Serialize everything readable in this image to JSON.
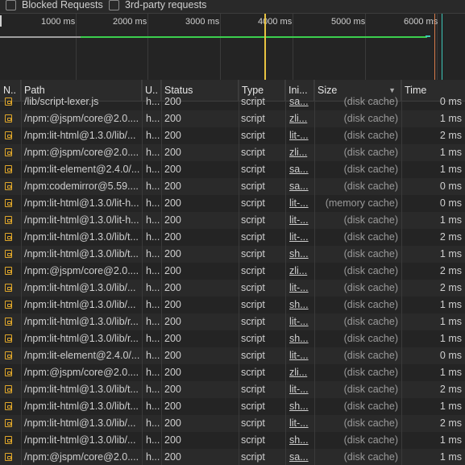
{
  "filter_bar": {
    "blocked_requests_label": "Blocked Requests",
    "third_party_label": "3rd-party requests"
  },
  "overview": {
    "tick_labels": [
      "1000 ms",
      "2000 ms",
      "3000 ms",
      "4000 ms",
      "5000 ms",
      "6000 ms"
    ],
    "colors": {
      "green": "#3ccf4e",
      "gray": "#9e9e9e",
      "dcl_line": "#e8c341",
      "load_line": "#d87c4b",
      "teal": "#3cc6b8"
    }
  },
  "table": {
    "columns": {
      "name": "N..",
      "path": "Path",
      "url": "U..",
      "status": "Status",
      "type": "Type",
      "initiator": "Ini...",
      "size": "Size",
      "time": "Time"
    },
    "sort_indicator": "▼",
    "rows": [
      {
        "path": "/lib/script-lexer.js",
        "url": "h...",
        "status": "200",
        "type": "script",
        "initiator": "sa...",
        "size": "(disk cache)",
        "time": "0 ms"
      },
      {
        "path": "/npm:@jspm/core@2.0....",
        "url": "h...",
        "status": "200",
        "type": "script",
        "initiator": "zli...",
        "size": "(disk cache)",
        "time": "1 ms"
      },
      {
        "path": "/npm:lit-html@1.3.0/lib/...",
        "url": "h...",
        "status": "200",
        "type": "script",
        "initiator": "lit-...",
        "size": "(disk cache)",
        "time": "2 ms"
      },
      {
        "path": "/npm:@jspm/core@2.0....",
        "url": "h...",
        "status": "200",
        "type": "script",
        "initiator": "zli...",
        "size": "(disk cache)",
        "time": "1 ms"
      },
      {
        "path": "/npm:lit-element@2.4.0/...",
        "url": "h...",
        "status": "200",
        "type": "script",
        "initiator": "sa...",
        "size": "(disk cache)",
        "time": "1 ms"
      },
      {
        "path": "/npm:codemirror@5.59....",
        "url": "h...",
        "status": "200",
        "type": "script",
        "initiator": "sa...",
        "size": "(disk cache)",
        "time": "0 ms"
      },
      {
        "path": "/npm:lit-html@1.3.0/lit-h...",
        "url": "h...",
        "status": "200",
        "type": "script",
        "initiator": "lit-...",
        "size": "(memory cache)",
        "time": "0 ms"
      },
      {
        "path": "/npm:lit-html@1.3.0/lit-h...",
        "url": "h...",
        "status": "200",
        "type": "script",
        "initiator": "lit-...",
        "size": "(disk cache)",
        "time": "1 ms"
      },
      {
        "path": "/npm:lit-html@1.3.0/lib/t...",
        "url": "h...",
        "status": "200",
        "type": "script",
        "initiator": "lit-...",
        "size": "(disk cache)",
        "time": "2 ms"
      },
      {
        "path": "/npm:lit-html@1.3.0/lib/t...",
        "url": "h...",
        "status": "200",
        "type": "script",
        "initiator": "sh...",
        "size": "(disk cache)",
        "time": "1 ms"
      },
      {
        "path": "/npm:@jspm/core@2.0....",
        "url": "h...",
        "status": "200",
        "type": "script",
        "initiator": "zli...",
        "size": "(disk cache)",
        "time": "2 ms"
      },
      {
        "path": "/npm:lit-html@1.3.0/lib/...",
        "url": "h...",
        "status": "200",
        "type": "script",
        "initiator": "lit-...",
        "size": "(disk cache)",
        "time": "2 ms"
      },
      {
        "path": "/npm:lit-html@1.3.0/lib/...",
        "url": "h...",
        "status": "200",
        "type": "script",
        "initiator": "sh...",
        "size": "(disk cache)",
        "time": "1 ms"
      },
      {
        "path": "/npm:lit-html@1.3.0/lib/r...",
        "url": "h...",
        "status": "200",
        "type": "script",
        "initiator": "lit-...",
        "size": "(disk cache)",
        "time": "1 ms"
      },
      {
        "path": "/npm:lit-html@1.3.0/lib/r...",
        "url": "h...",
        "status": "200",
        "type": "script",
        "initiator": "sh...",
        "size": "(disk cache)",
        "time": "1 ms"
      },
      {
        "path": "/npm:lit-element@2.4.0/...",
        "url": "h...",
        "status": "200",
        "type": "script",
        "initiator": "lit-...",
        "size": "(disk cache)",
        "time": "0 ms"
      },
      {
        "path": "/npm:@jspm/core@2.0....",
        "url": "h...",
        "status": "200",
        "type": "script",
        "initiator": "zli...",
        "size": "(disk cache)",
        "time": "1 ms"
      },
      {
        "path": "/npm:lit-html@1.3.0/lib/t...",
        "url": "h...",
        "status": "200",
        "type": "script",
        "initiator": "lit-...",
        "size": "(disk cache)",
        "time": "2 ms"
      },
      {
        "path": "/npm:lit-html@1.3.0/lib/t...",
        "url": "h...",
        "status": "200",
        "type": "script",
        "initiator": "sh...",
        "size": "(disk cache)",
        "time": "1 ms"
      },
      {
        "path": "/npm:lit-html@1.3.0/lib/...",
        "url": "h...",
        "status": "200",
        "type": "script",
        "initiator": "lit-...",
        "size": "(disk cache)",
        "time": "2 ms"
      },
      {
        "path": "/npm:lit-html@1.3.0/lib/...",
        "url": "h...",
        "status": "200",
        "type": "script",
        "initiator": "sh...",
        "size": "(disk cache)",
        "time": "1 ms"
      },
      {
        "path": "/npm:@jspm/core@2.0....",
        "url": "h...",
        "status": "200",
        "type": "script",
        "initiator": "sa...",
        "size": "(disk cache)",
        "time": "1 ms"
      }
    ]
  }
}
